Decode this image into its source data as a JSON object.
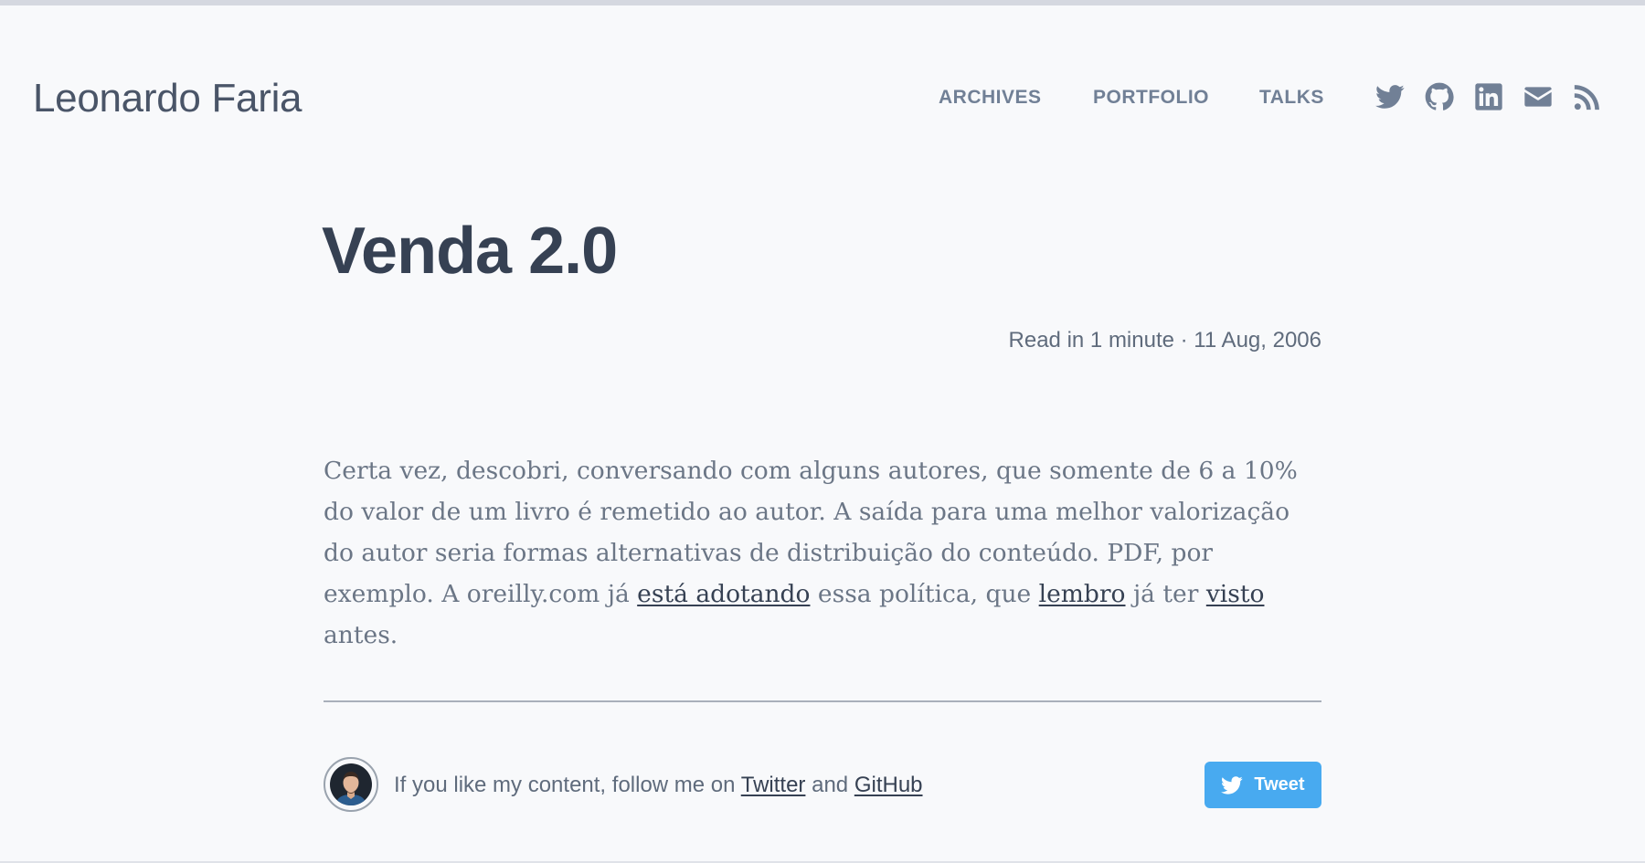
{
  "site": {
    "brand": "Leonardo Faria",
    "nav": [
      {
        "label": "ARCHIVES"
      },
      {
        "label": "PORTFOLIO"
      },
      {
        "label": "TALKS"
      }
    ],
    "social_icons": [
      "twitter-icon",
      "github-icon",
      "linkedin-icon",
      "email-icon",
      "rss-icon"
    ]
  },
  "post": {
    "title": "Venda 2.0",
    "meta": "Read in 1 minute · 11 Aug, 2006",
    "body": {
      "text_1": "Certa vez, descobri, conversando com alguns autores, que somente de 6 a 10% do valor de um livro é remetido ao autor. A saída para uma melhor valorização do autor seria formas alternativas de distribuição do conteúdo. PDF, por exemplo. A oreilly.com já ",
      "link_1": "está adotando",
      "text_2": " essa política, que ",
      "link_2": "lembro",
      "text_3": " já ter ",
      "link_3": "visto",
      "text_4": " antes."
    }
  },
  "footer": {
    "follow_prefix": "If you like my content, follow me on ",
    "twitter_link": "Twitter",
    "and_text": " and ",
    "github_link": "GitHub",
    "tweet_label": "Tweet"
  },
  "colors": {
    "background": "#f8f9fb",
    "heading": "#364153",
    "nav": "#718096",
    "tweet_button": "#48aaf0"
  }
}
